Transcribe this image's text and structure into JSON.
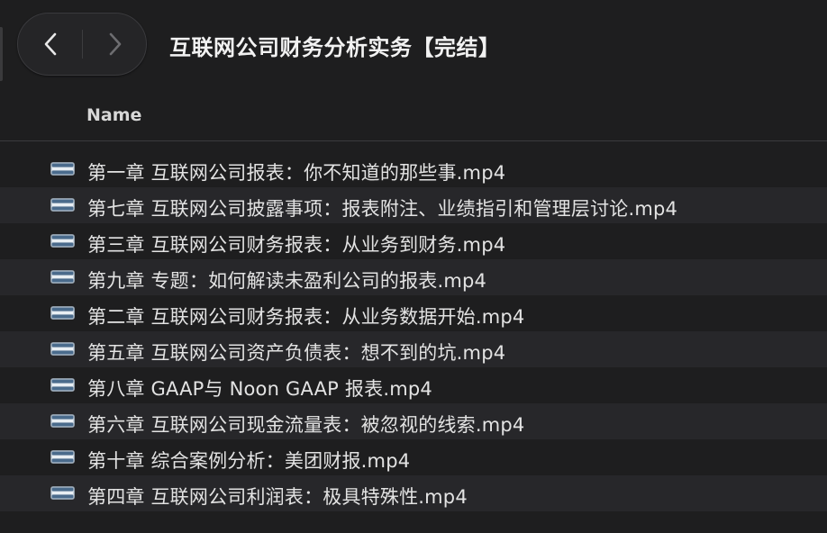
{
  "toolbar": {
    "title": "互联网公司财务分析实务【完结】",
    "back_icon": "chevron-left-icon",
    "forward_icon": "chevron-right-icon"
  },
  "columns": {
    "name": "Name"
  },
  "files": [
    {
      "name": "第一章 互联网公司报表：你不知道的那些事.mp4",
      "icon": "video-file-icon"
    },
    {
      "name": "第七章 互联网公司披露事项：报表附注、业绩指引和管理层讨论.mp4",
      "icon": "video-file-icon"
    },
    {
      "name": "第三章 互联网公司财务报表：从业务到财务.mp4",
      "icon": "video-file-icon"
    },
    {
      "name": "第九章 专题：如何解读未盈利公司的报表.mp4",
      "icon": "video-file-icon"
    },
    {
      "name": "第二章 互联网公司财务报表：从业务数据开始.mp4",
      "icon": "video-file-icon"
    },
    {
      "name": "第五章 互联网公司资产负债表：想不到的坑.mp4",
      "icon": "video-file-icon"
    },
    {
      "name": "第八章 GAAP与 Noon GAAP 报表.mp4",
      "icon": "video-file-icon"
    },
    {
      "name": "第六章 互联网公司现金流量表：被忽视的线索.mp4",
      "icon": "video-file-icon"
    },
    {
      "name": "第十章 综合案例分析：美团财报.mp4",
      "icon": "video-file-icon"
    },
    {
      "name": "第四章 互联网公司利润表：极具特殊性.mp4",
      "icon": "video-file-icon"
    }
  ],
  "colors": {
    "background": "#1e1e1f",
    "row_alt": "#27272a",
    "text": "#e3e3e3"
  }
}
